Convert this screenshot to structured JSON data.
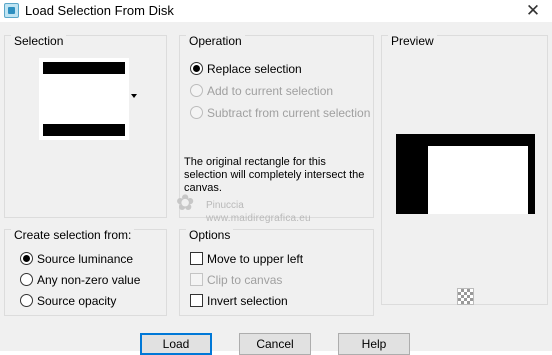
{
  "window": {
    "title": "Load Selection From Disk",
    "close_glyph": "✕"
  },
  "selection": {
    "group_title": "Selection"
  },
  "operation": {
    "group_title": "Operation",
    "options": [
      {
        "label": "Replace selection",
        "selected": true,
        "enabled": true
      },
      {
        "label": "Add to current selection",
        "selected": false,
        "enabled": false
      },
      {
        "label": "Subtract from current selection",
        "selected": false,
        "enabled": false
      }
    ],
    "info": "The original rectangle for this selection will completely intersect the canvas."
  },
  "preview": {
    "group_title": "Preview"
  },
  "create_from": {
    "group_title": "Create selection from:",
    "options": [
      {
        "label": "Source luminance",
        "selected": true
      },
      {
        "label": "Any non-zero value",
        "selected": false
      },
      {
        "label": "Source opacity",
        "selected": false
      }
    ]
  },
  "options": {
    "group_title": "Options",
    "items": [
      {
        "label": "Move to upper left",
        "checked": false,
        "enabled": true
      },
      {
        "label": "Clip to canvas",
        "checked": false,
        "enabled": false
      },
      {
        "label": "Invert selection",
        "checked": false,
        "enabled": true
      }
    ]
  },
  "watermark": {
    "name": "Pinuccia",
    "url": "www.maidiregrafica.eu"
  },
  "buttons": {
    "load": "Load",
    "cancel": "Cancel",
    "help": "Help"
  },
  "icons": {
    "app": "selection-icon",
    "close": "close-icon",
    "dropdown": "chevron-down-icon",
    "transparency": "checkerboard-icon"
  }
}
